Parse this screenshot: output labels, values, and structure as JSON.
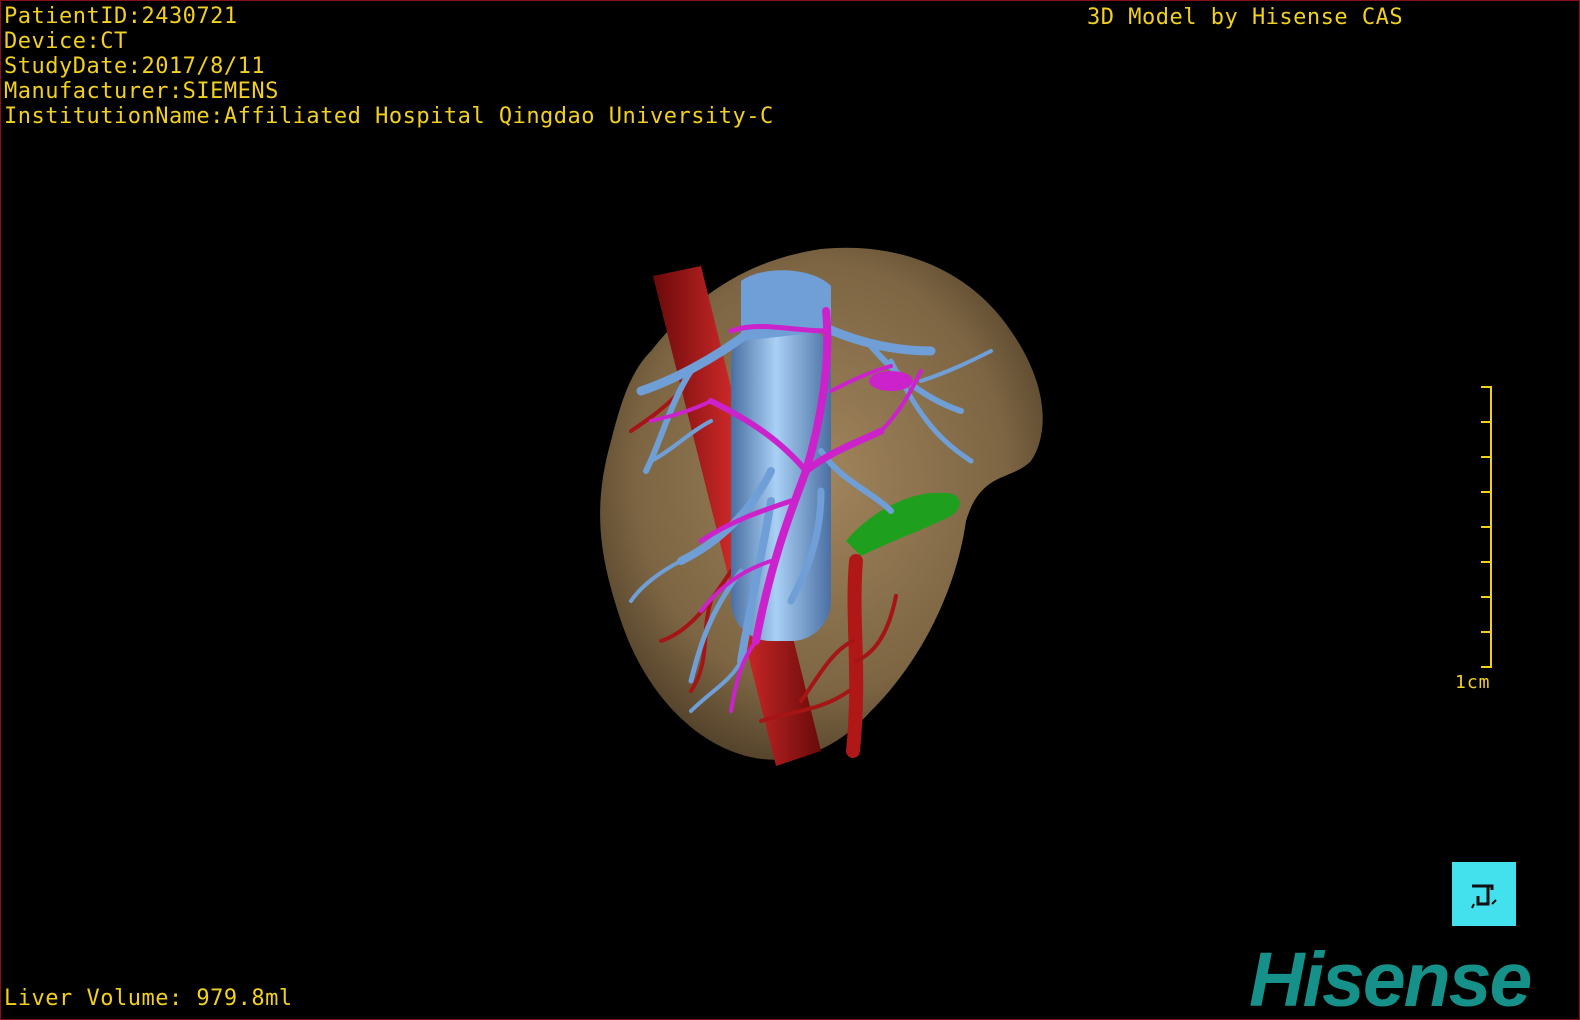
{
  "overlay": {
    "patient_id": "PatientID:2430721",
    "device": "Device:CT",
    "study_date": "StudyDate:2017/8/11",
    "manufacturer": "Manufacturer:SIEMENS",
    "institution": "InstitutionName:Affiliated Hospital Qingdao University-C",
    "model_credit": "3D Model by Hisense CAS",
    "liver_volume": "Liver Volume: 979.8ml"
  },
  "scale_bar": {
    "label": "1cm"
  },
  "brand": {
    "name": "Hisense"
  },
  "colors": {
    "overlay_text": "#f2d020",
    "liver": "#8a6f4a",
    "hepatic_vein": "#6f9fd6",
    "portal_vein": "#cc22cc",
    "artery_ivc": "#b01818",
    "gallbladder": "#1ea01e",
    "brand": "#16918a",
    "orient_button": "#43e0ee"
  },
  "icons": {
    "orientation": "orientation-cube-icon"
  }
}
